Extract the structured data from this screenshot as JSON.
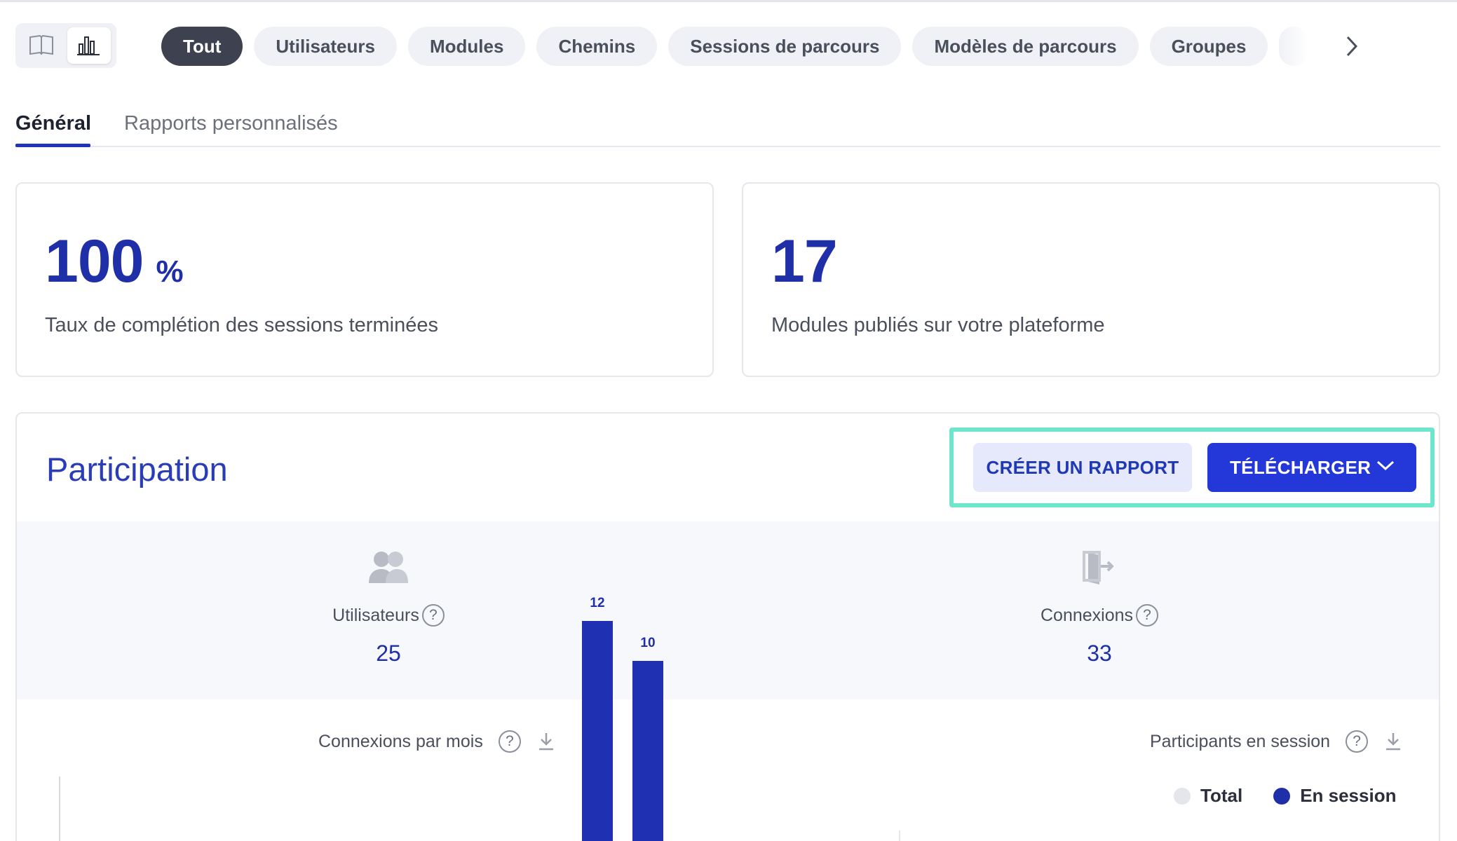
{
  "filters": {
    "chips": [
      "Tout",
      "Utilisateurs",
      "Modules",
      "Chemins",
      "Sessions de parcours",
      "Modèles de parcours",
      "Groupes"
    ],
    "active": "Tout"
  },
  "tabs": [
    "Général",
    "Rapports personnalisés"
  ],
  "cards": {
    "completion": {
      "value": "100",
      "unit": "%",
      "label": "Taux de complétion des sessions terminées"
    },
    "modules": {
      "value": "17",
      "label": "Modules publiés sur votre plateforme"
    }
  },
  "participation": {
    "title": "Participation",
    "create_report": "CRÉER UN RAPPORT",
    "download": "TÉLÉCHARGER",
    "metrics": {
      "users": {
        "label": "Utilisateurs",
        "value": "25"
      },
      "connections": {
        "label": "Connexions",
        "value": "33"
      }
    },
    "help_glyph": "?"
  },
  "charts": {
    "connections_title": "Connexions par mois",
    "participants_title": "Participants en session",
    "legend": {
      "total": "Total",
      "in_session": "En session"
    }
  },
  "colors": {
    "accent": "#2438d9",
    "highlight": "#6ee6cc",
    "legend_total": "#e5e6eb",
    "legend_in_session": "#1f2fa8"
  },
  "chart_data": {
    "type": "bar",
    "title": "Connexions par mois",
    "values": [
      12,
      10
    ],
    "labels": [
      "12",
      "10"
    ]
  }
}
